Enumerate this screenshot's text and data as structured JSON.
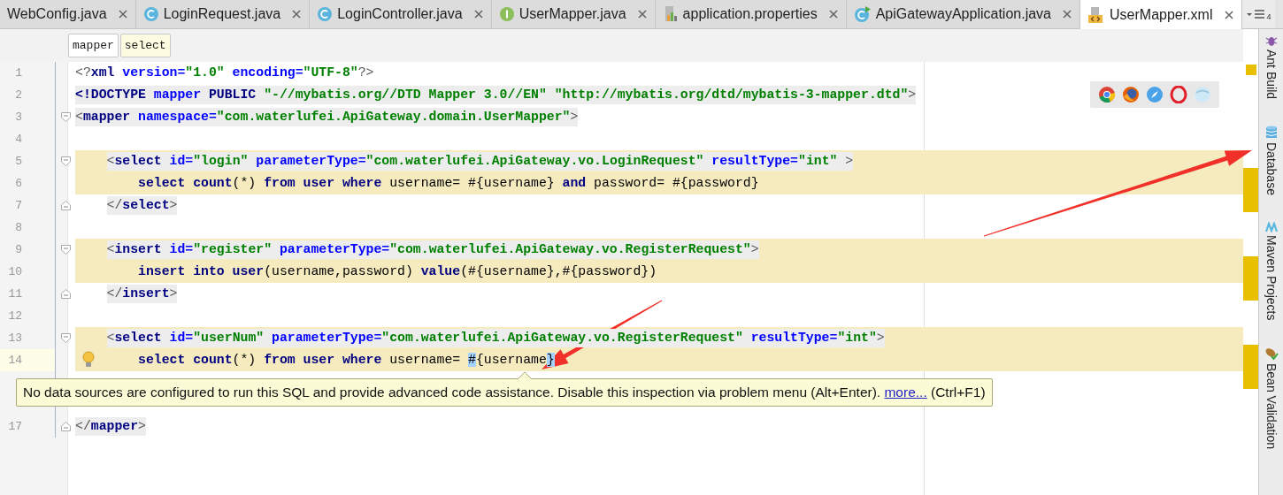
{
  "tabs": [
    {
      "label": "WebConfig.java",
      "kind": "none",
      "selected": false
    },
    {
      "label": "LoginRequest.java",
      "kind": "class",
      "selected": false
    },
    {
      "label": "LoginController.java",
      "kind": "class",
      "selected": false
    },
    {
      "label": "UserMapper.java",
      "kind": "interface",
      "selected": false
    },
    {
      "label": "application.properties",
      "kind": "properties",
      "selected": false
    },
    {
      "label": "ApiGatewayApplication.java",
      "kind": "app",
      "selected": false
    },
    {
      "label": "UserMapper.xml",
      "kind": "xml",
      "selected": true
    }
  ],
  "hidden_tabs_count": "4",
  "breadcrumbs": [
    {
      "label": "mapper",
      "selected": false
    },
    {
      "label": "select",
      "selected": true
    }
  ],
  "lines": [
    {
      "number": "1",
      "current": false,
      "highlighted": false,
      "tagged": false,
      "fold_start": false,
      "fold_end": false,
      "bulb": false,
      "segments": [
        {
          "p": "<?"
        },
        {
          "tag": "xml"
        },
        {
          "attr": " version="
        },
        {
          "val": "\"1.0\""
        },
        {
          "attr": " encoding="
        },
        {
          "val": "\"UTF-8\""
        },
        {
          "p": "?>"
        }
      ]
    },
    {
      "number": "2",
      "current": false,
      "highlighted": false,
      "tagged": true,
      "fold_start": false,
      "fold_end": false,
      "bulb": false,
      "segments": [
        {
          "tag": "<!DOCTYPE"
        },
        {
          "attr": " mapper"
        },
        {
          "tag": " PUBLIC"
        },
        {
          "val": " \"-//mybatis.org//DTD Mapper 3.0//EN\""
        },
        {
          "val": " \"http://mybatis.org/dtd/mybatis-3-mapper.dtd\""
        },
        {
          "p": ">"
        }
      ]
    },
    {
      "number": "3",
      "current": false,
      "highlighted": false,
      "tagged": true,
      "fold_start": true,
      "fold_end": false,
      "bulb": false,
      "segments": [
        {
          "p": "<"
        },
        {
          "tag": "mapper"
        },
        {
          "attr": " namespace="
        },
        {
          "val": "\"com.waterlufei.ApiGateway.domain.UserMapper\""
        },
        {
          "p": ">"
        }
      ]
    },
    {
      "number": "4",
      "current": false,
      "highlighted": false,
      "tagged": false,
      "fold_start": false,
      "fold_end": false,
      "bulb": false
    },
    {
      "number": "5",
      "current": false,
      "highlighted": true,
      "tagged": true,
      "fold_start": true,
      "fold_end": false,
      "bulb": false,
      "segments": [
        {
          "p": "    <"
        },
        {
          "tag": "select"
        },
        {
          "attr": " id="
        },
        {
          "val": "\"login\""
        },
        {
          "attr": " parameterType="
        },
        {
          "val": "\"com.waterlufei.ApiGateway.vo.LoginRequest\""
        },
        {
          "attr": " resultType="
        },
        {
          "val": "\"int\""
        },
        {
          "p": " >"
        }
      ]
    },
    {
      "number": "6",
      "current": false,
      "highlighted": true,
      "tagged": false,
      "fold_start": false,
      "fold_end": false,
      "bulb": false,
      "segments": [
        {
          "kw": "        select count"
        },
        {
          "txt": "(*) "
        },
        {
          "kw": "from user where"
        },
        {
          "txt": " username= #{username} "
        },
        {
          "kw": "and"
        },
        {
          "txt": " password= #{password}"
        }
      ]
    },
    {
      "number": "7",
      "current": false,
      "highlighted": false,
      "tagged": true,
      "fold_start": false,
      "fold_end": true,
      "bulb": false,
      "segments": [
        {
          "p": "    </"
        },
        {
          "tag": "select"
        },
        {
          "p": ">"
        }
      ]
    },
    {
      "number": "8",
      "current": false,
      "highlighted": false,
      "tagged": false,
      "fold_start": false,
      "fold_end": false,
      "bulb": false
    },
    {
      "number": "9",
      "current": false,
      "highlighted": true,
      "tagged": true,
      "fold_start": true,
      "fold_end": false,
      "bulb": false,
      "segments": [
        {
          "p": "    <"
        },
        {
          "tag": "insert"
        },
        {
          "attr": " id="
        },
        {
          "val": "\"register\""
        },
        {
          "attr": " parameterType="
        },
        {
          "val": "\"com.waterlufei.ApiGateway.vo.RegisterRequest\""
        },
        {
          "p": ">"
        }
      ]
    },
    {
      "number": "10",
      "current": false,
      "highlighted": true,
      "tagged": false,
      "fold_start": false,
      "fold_end": false,
      "bulb": false,
      "segments": [
        {
          "kw": "        insert into user"
        },
        {
          "txt": "(username,password) "
        },
        {
          "kw": "value"
        },
        {
          "txt": "(#{username},#{password})"
        }
      ]
    },
    {
      "number": "11",
      "current": false,
      "highlighted": false,
      "tagged": true,
      "fold_start": false,
      "fold_end": true,
      "bulb": false,
      "segments": [
        {
          "p": "    </"
        },
        {
          "tag": "insert"
        },
        {
          "p": ">"
        }
      ]
    },
    {
      "number": "12",
      "current": false,
      "highlighted": false,
      "tagged": false,
      "fold_start": false,
      "fold_end": false,
      "bulb": false
    },
    {
      "number": "13",
      "current": false,
      "highlighted": true,
      "tagged": true,
      "fold_start": true,
      "fold_end": false,
      "bulb": false,
      "segments": [
        {
          "p": "    <"
        },
        {
          "tag": "select"
        },
        {
          "attr": " id="
        },
        {
          "val": "\"userNum\""
        },
        {
          "attr": " parameterType="
        },
        {
          "val": "\"com.waterlufei.ApiGateway.vo.RegisterRequest\""
        },
        {
          "attr": " resultType="
        },
        {
          "val": "\"int\""
        },
        {
          "p": ">"
        }
      ]
    },
    {
      "number": "14",
      "current": true,
      "highlighted": true,
      "tagged": false,
      "fold_start": false,
      "fold_end": false,
      "bulb": true,
      "segments": [
        {
          "kw": "        select count"
        },
        {
          "txt": "(*) "
        },
        {
          "kw": "from user where"
        },
        {
          "txt": " username= "
        },
        {
          "hl": "#"
        },
        {
          "txt": "{username"
        },
        {
          "hl": "}"
        }
      ]
    },
    {
      "current": false,
      "highlighted": false,
      "tagged": false,
      "fold_start": false,
      "fold_end": false,
      "bulb": false
    },
    {
      "current": false,
      "highlighted": false,
      "tagged": false,
      "fold_start": false,
      "fold_end": false,
      "bulb": false
    },
    {
      "number": "17",
      "current": false,
      "highlighted": false,
      "tagged": true,
      "fold_start": false,
      "fold_end": true,
      "bulb": false,
      "segments": [
        {
          "p": "</"
        },
        {
          "tag": "mapper"
        },
        {
          "p": ">"
        }
      ]
    }
  ],
  "tooltip": {
    "text": "No data sources are configured to run this SQL and provide advanced code assistance. Disable this inspection via problem menu (Alt+Enter).",
    "link": "more...",
    "shortcut": "(Ctrl+F1)"
  },
  "tool_windows": [
    {
      "label": "Ant Build"
    },
    {
      "label": "Database"
    },
    {
      "label": "Maven Projects"
    },
    {
      "label": "Bean Validation"
    }
  ]
}
